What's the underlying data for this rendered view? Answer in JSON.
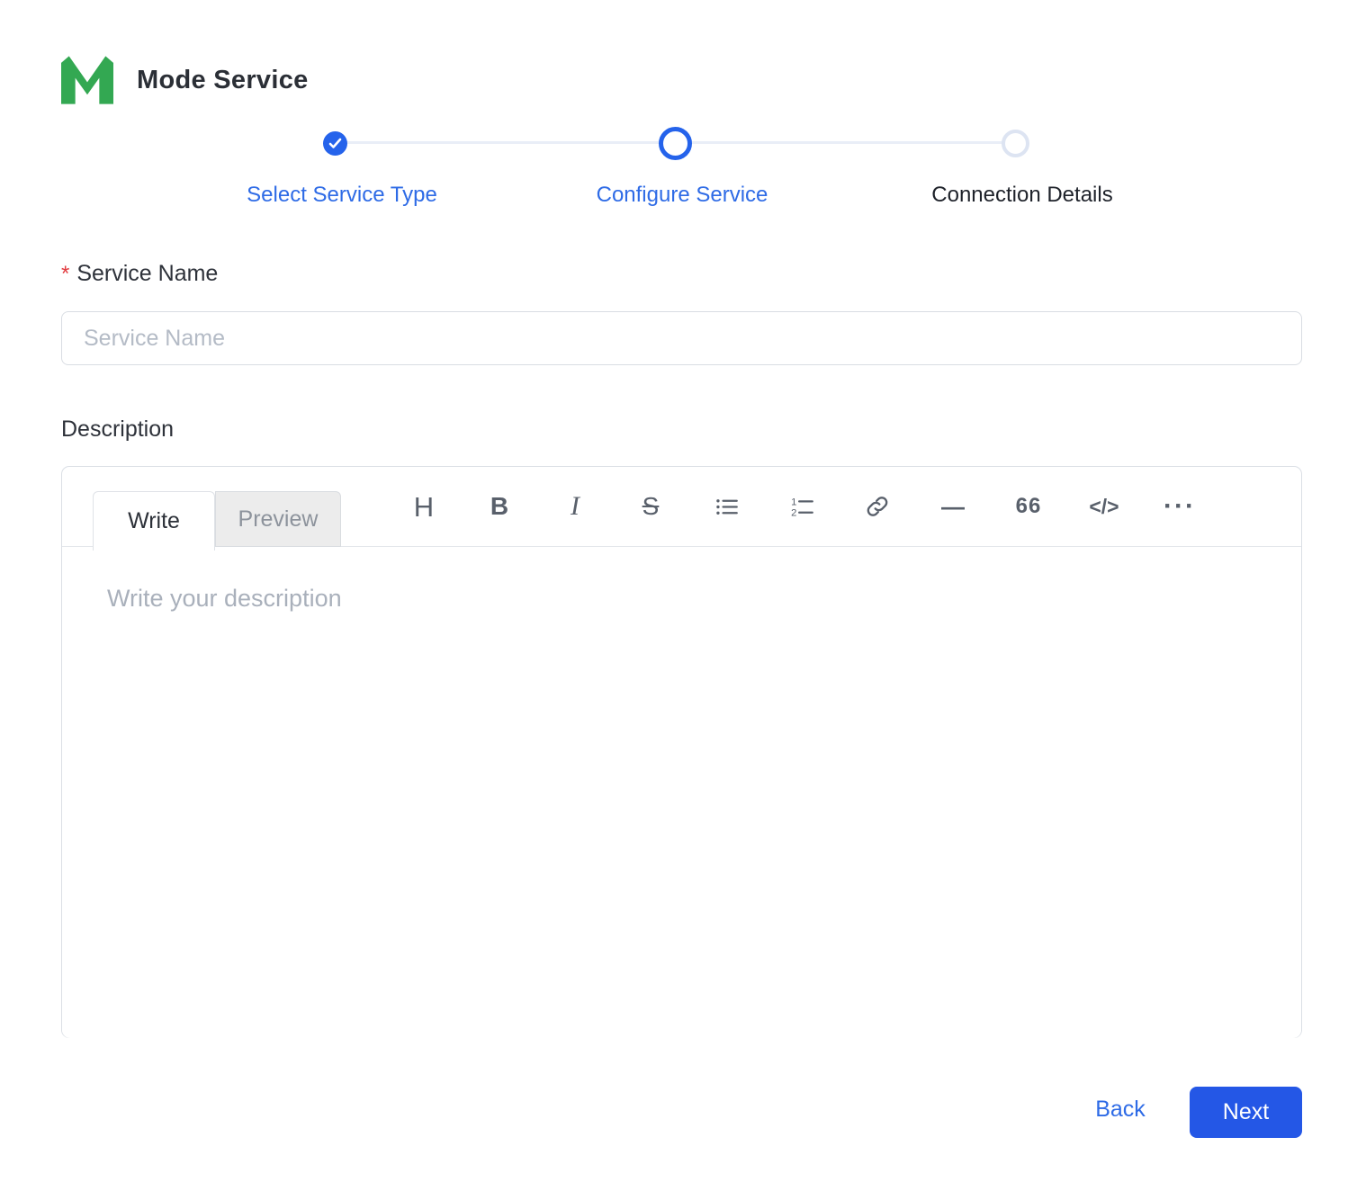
{
  "app": {
    "title": "Mode Service"
  },
  "stepper": {
    "steps": [
      {
        "label": "Select Service Type",
        "state": "completed"
      },
      {
        "label": "Configure Service",
        "state": "active"
      },
      {
        "label": "Connection Details",
        "state": "upcoming"
      }
    ]
  },
  "form": {
    "service_name": {
      "label": "Service Name",
      "required_marker": "*",
      "placeholder": "Service Name",
      "value": ""
    },
    "description": {
      "label": "Description",
      "editor": {
        "tabs": [
          {
            "label": "Write",
            "active": true
          },
          {
            "label": "Preview",
            "active": false
          }
        ],
        "toolbar": [
          {
            "name": "heading",
            "glyph": "H"
          },
          {
            "name": "bold",
            "glyph": "B"
          },
          {
            "name": "italic",
            "glyph": "I"
          },
          {
            "name": "strikethrough",
            "glyph": "S"
          },
          {
            "name": "unordered-list",
            "glyph": ""
          },
          {
            "name": "ordered-list",
            "glyph": ""
          },
          {
            "name": "link",
            "glyph": ""
          },
          {
            "name": "horizontal-rule",
            "glyph": "—"
          },
          {
            "name": "quote",
            "glyph": "66"
          },
          {
            "name": "code",
            "glyph": "</>"
          },
          {
            "name": "kebab",
            "glyph": "···"
          }
        ],
        "placeholder": "Write your description",
        "value": ""
      }
    }
  },
  "footer": {
    "back_label": "Back",
    "next_label": "Next"
  },
  "colors": {
    "accent": "#2563eb",
    "button_blue": "#2457e6",
    "logo_green": "#33a852",
    "required_red": "#e23b3f"
  }
}
